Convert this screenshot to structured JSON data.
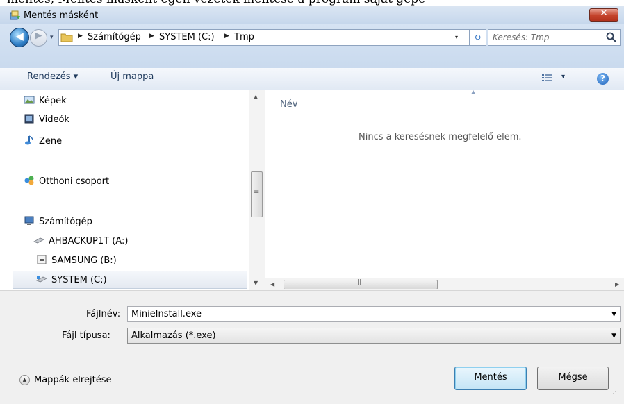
{
  "background_text": "mentés, Mentés másként egen vezeték mentése a program saját gépé",
  "window": {
    "title": "Mentés másként",
    "close_glyph": "✕"
  },
  "address": {
    "back_glyph": "◀",
    "forward_glyph": "▶",
    "dropdown_glyph": "▾",
    "breadcrumbs": [
      "Számítógép",
      "SYSTEM (C:)",
      "Tmp"
    ],
    "separator_glyph": "▶",
    "refresh_glyph": "↻",
    "search_placeholder": "Keresés: Tmp"
  },
  "toolbar": {
    "organize_label": "Rendezés ▾",
    "new_folder_label": "Új mappa",
    "view_icon": "details-view-icon",
    "view_dropdown_glyph": "▾",
    "help_glyph": "?"
  },
  "navigation": {
    "items": [
      {
        "label": "Képek",
        "icon": "pictures-icon"
      },
      {
        "label": "Videók",
        "icon": "videos-icon"
      },
      {
        "label": "Zene",
        "icon": "music-icon"
      },
      {
        "label": "Otthoni csoport",
        "icon": "homegroup-icon"
      },
      {
        "label": "Számítógép",
        "icon": "computer-icon"
      },
      {
        "label": "AHBACKUP1T (A:)",
        "icon": "drive-icon"
      },
      {
        "label": "SAMSUNG (B:)",
        "icon": "removable-drive-icon"
      },
      {
        "label": "SYSTEM (C:)",
        "icon": "system-drive-icon",
        "selected": true
      }
    ]
  },
  "file_list": {
    "column_name": "Név",
    "empty_message": "Nincs a keresésnek megfelelő elem."
  },
  "form": {
    "filename_label": "Fájlnév:",
    "filename_value": "MinieInstall.exe",
    "filetype_label": "Fájl típusa:",
    "filetype_value": "Alkalmazás (*.exe)"
  },
  "footer": {
    "hide_folders_label": "Mappák elrejtése",
    "save_label": "Mentés",
    "cancel_label": "Mégse"
  },
  "colors": {
    "titlebar": "#c6d7ec",
    "close_button": "#c4432b",
    "link_text": "#1e395b",
    "primary_button_border": "#3c7fb1"
  }
}
